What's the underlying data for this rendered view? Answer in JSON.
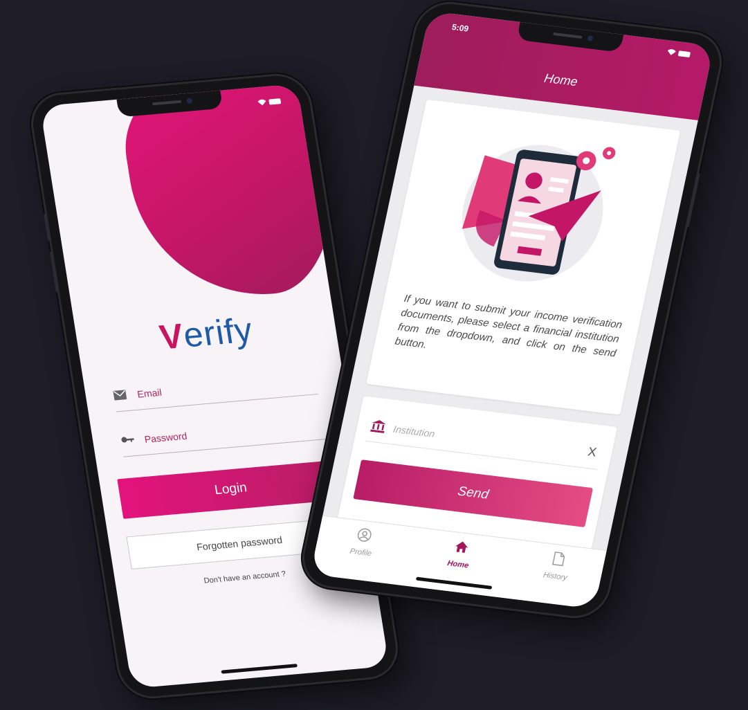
{
  "login_screen": {
    "logo_v": "V",
    "logo_rest": "erify",
    "email_placeholder": "Email",
    "password_placeholder": "Password",
    "login_label": "Login",
    "forgot_label": "Forgotten password",
    "signup_text": "Don't have an account ?"
  },
  "home_screen": {
    "status_time": "5:09",
    "title": "Home",
    "description": "If you want to submit your income verification documents, please select a financial institution from the dropdown, and click on the send button.",
    "institution_placeholder": "Institution",
    "clear_symbol": "X",
    "send_label": "Send",
    "nav": [
      {
        "label": "Profile",
        "icon": "profile-icon"
      },
      {
        "label": "Home",
        "icon": "home-icon"
      },
      {
        "label": "History",
        "icon": "document-icon"
      }
    ]
  },
  "colors": {
    "background": "#1d1c27",
    "brand_magenta": "#c8155f",
    "logo_blue": "#1f5aa8"
  }
}
